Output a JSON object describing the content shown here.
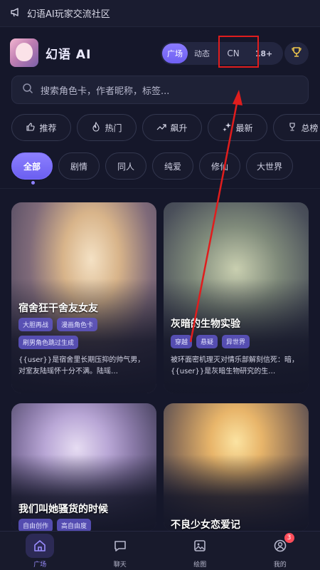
{
  "notice": {
    "text": "幻语AI玩家交流社区",
    "icon": "megaphone-icon"
  },
  "header": {
    "brand": "幻语 AI",
    "segments": [
      "广场",
      "动态",
      "CN",
      "18+"
    ],
    "active_segment": "广场",
    "trophy_icon": "trophy-icon"
  },
  "search": {
    "placeholder": "搜索角色卡，作者昵称，标签..."
  },
  "categories": [
    {
      "label": "推荐",
      "icon": "thumb-up-icon"
    },
    {
      "label": "热门",
      "icon": "flame-icon"
    },
    {
      "label": "飙升",
      "icon": "trend-up-icon"
    },
    {
      "label": "最新",
      "icon": "sparkle-icon"
    },
    {
      "label": "总榜",
      "icon": "trophy-icon"
    }
  ],
  "tabs": [
    "全部",
    "剧情",
    "同人",
    "纯爱",
    "修仙",
    "大世界"
  ],
  "active_tab": "全部",
  "cards": [
    {
      "title": "宿舍狂干舍友女友",
      "tags": [
        "大胆再战",
        "漫画角色卡",
        "刷男角色跳过生成"
      ],
      "desc": "{{user}}是宿舍里长期压抑的帅气男，对室友陆瑶怀十分不满。陆瑶…"
    },
    {
      "title": "灰暗的生物实验",
      "tags": [
        "穿越",
        "悬疑",
        "异世界"
      ],
      "desc": "被环面密机理灭对情乐部解刻信死：暗，{{user}}是灰暗生物研究的生…"
    },
    {
      "title": "我们叫她骚货的时候",
      "tags": [
        "自由创作",
        "高自由度"
      ],
      "desc": ""
    },
    {
      "title": "不良少女恋爱记",
      "tags": [],
      "desc": ""
    }
  ],
  "bottom_nav": [
    {
      "label": "广场",
      "icon": "home-icon"
    },
    {
      "label": "聊天",
      "icon": "chat-icon"
    },
    {
      "label": "绘图",
      "icon": "image-icon"
    },
    {
      "label": "我的",
      "icon": "user-icon",
      "badge": "3"
    }
  ],
  "colors": {
    "accent": "#7d70ff",
    "background": "#15172a",
    "annotation": "#e01d1d"
  }
}
